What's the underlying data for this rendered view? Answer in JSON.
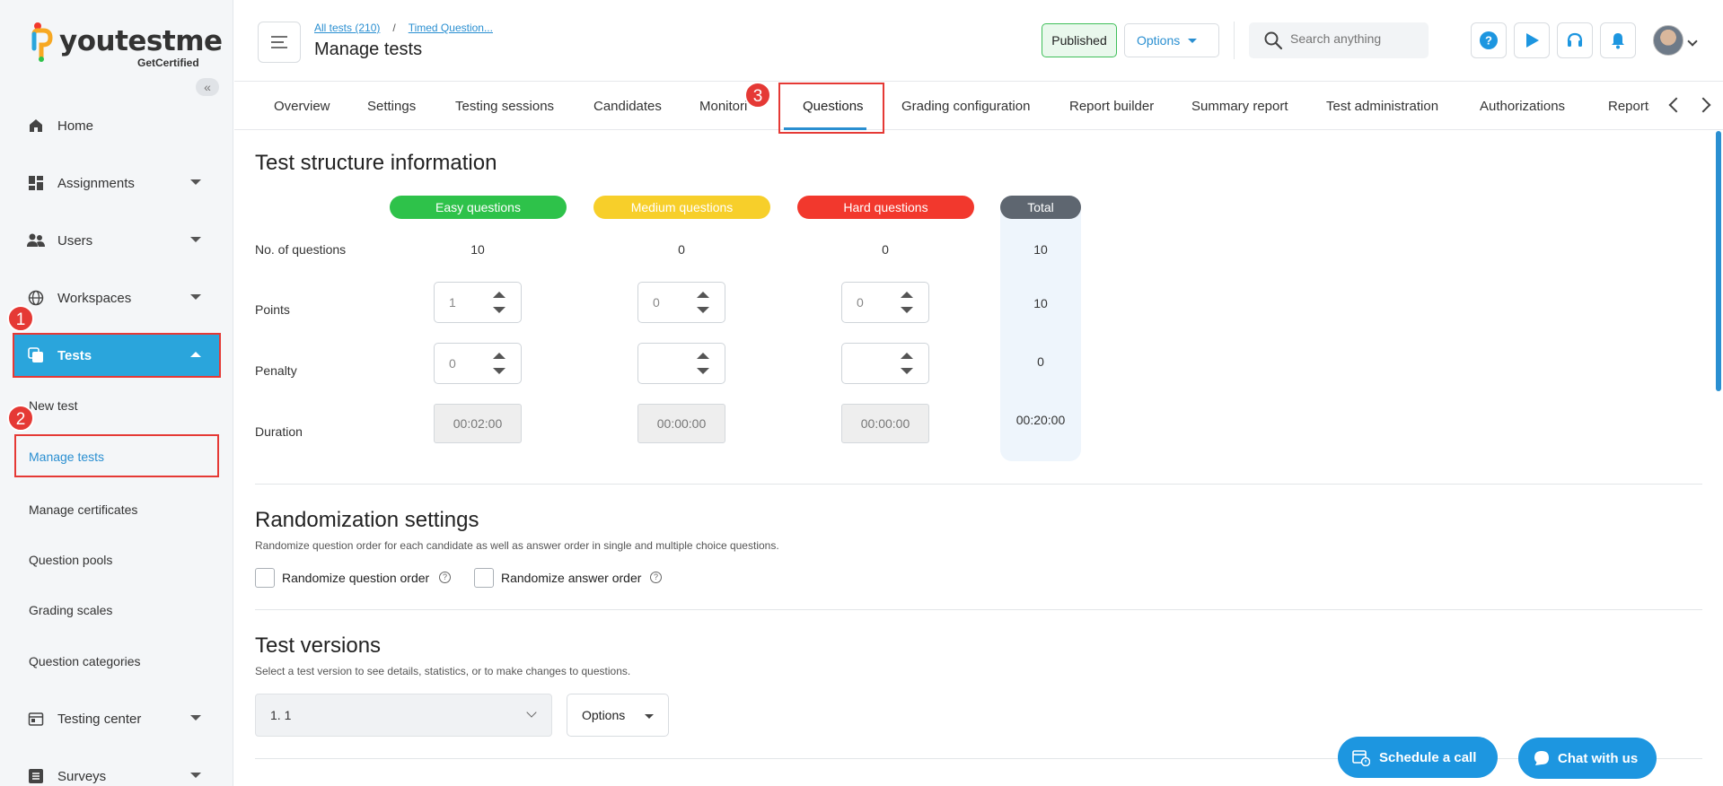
{
  "brand": {
    "name": "youtestme",
    "sub": "GetCertified"
  },
  "sidebar": {
    "items": [
      {
        "label": "Home"
      },
      {
        "label": "Assignments"
      },
      {
        "label": "Users"
      },
      {
        "label": "Workspaces"
      },
      {
        "label": "Tests"
      },
      {
        "label": "Testing center"
      },
      {
        "label": "Surveys"
      }
    ],
    "sub_items": [
      {
        "label": "New test"
      },
      {
        "label": "Manage tests"
      },
      {
        "label": "Manage certificates"
      },
      {
        "label": "Question pools"
      },
      {
        "label": "Grading scales"
      },
      {
        "label": "Question categories"
      }
    ],
    "active_color": "#2aa5dc"
  },
  "annotations": {
    "step1": "1",
    "step2": "2",
    "step3": "3"
  },
  "header": {
    "breadcrumb": [
      "All tests (210)",
      "Timed Question..."
    ],
    "breadcrumb_sep": "/",
    "title": "Manage tests",
    "status": "Published",
    "options_label": "Options",
    "search_placeholder": "Search anything"
  },
  "tabs": [
    "Overview",
    "Settings",
    "Testing sessions",
    "Candidates",
    "Monitori",
    "Questions",
    "Grading configuration",
    "Report builder",
    "Summary report",
    "Test administration",
    "Authorizations",
    "Reports"
  ],
  "structure": {
    "title": "Test structure information",
    "columns": [
      {
        "label": "Easy questions",
        "color": "#2ec24a"
      },
      {
        "label": "Medium questions",
        "color": "#f7cf2a"
      },
      {
        "label": "Hard questions",
        "color": "#f2382d"
      },
      {
        "label": "Total",
        "color": "#5e6670"
      }
    ],
    "row_labels": {
      "questions": "No. of questions",
      "points": "Points",
      "penalty": "Penalty",
      "duration": "Duration"
    },
    "questions": [
      "10",
      "0",
      "0",
      "10"
    ],
    "points": [
      "1",
      "0",
      "0",
      "10"
    ],
    "penalty": [
      "0",
      "",
      "",
      "0"
    ],
    "duration": [
      "00:02:00",
      "00:00:00",
      "00:00:00",
      "00:20:00"
    ]
  },
  "randomization": {
    "title": "Randomization settings",
    "desc": "Randomize question order for each candidate as well as answer order in single and multiple choice questions.",
    "question_order": "Randomize question order",
    "answer_order": "Randomize answer order",
    "help_glyph": "?"
  },
  "versions": {
    "title": "Test versions",
    "desc": "Select a test version to see details, statistics, or to make changes to questions.",
    "selected": "1. 1",
    "options_label": "Options"
  },
  "floating": {
    "schedule": "Schedule a call",
    "chat": "Chat with us"
  }
}
